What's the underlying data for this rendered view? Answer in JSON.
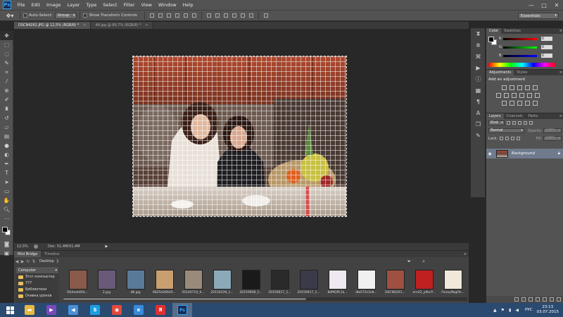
{
  "app": {
    "logo": "Ps"
  },
  "menu": [
    "File",
    "Edit",
    "Image",
    "Layer",
    "Type",
    "Select",
    "Filter",
    "View",
    "Window",
    "Help"
  ],
  "window_controls": {
    "minimize": "—",
    "maximize": "□",
    "close": "✕"
  },
  "options": {
    "auto_select_label": "Auto-Select:",
    "auto_select_target": "Group",
    "show_transform_label": "Show Transform Controls",
    "workspace": "Essentials"
  },
  "doc_tabs": [
    {
      "label": "DSCN4261.JPG @ 12,5% (RGB/8) *",
      "close": "×"
    },
    {
      "label": "48.jpg @ 66,7% (RGB/8) *",
      "close": "×"
    }
  ],
  "status": {
    "zoom": "12,5%",
    "doc_size": "Doc: 51,4M/51,4M",
    "arrow": "▶"
  },
  "bridge": {
    "tabs": [
      "Mini Bridge",
      "Timeline"
    ],
    "path": "Desktop",
    "path_arrow": "❯",
    "location": "Computer",
    "tree": [
      "Этот компьютер",
      "777",
      "Библиотеки",
      "Очивка уроков"
    ],
    "thumbnails": [
      {
        "label": "0Q4xdeD0c...",
        "color": "#8a5a4a"
      },
      {
        "label": "2.jpg",
        "color": "#6a5a7a"
      },
      {
        "label": "48.jpg",
        "color": "#5a7a9a"
      },
      {
        "label": "6825d266d5...",
        "color": "#c8a070"
      },
      {
        "label": "20140710_0...",
        "color": "#9a8a7a"
      },
      {
        "label": "20150228_1...",
        "color": "#8aaab8"
      },
      {
        "label": "20150608_1...",
        "color": "#1a1a1a"
      },
      {
        "label": "20150617_1...",
        "color": "#2a2a2a"
      },
      {
        "label": "20150617_1...",
        "color": "#3a3a4a"
      },
      {
        "label": "8dMQPL1k...",
        "color": "#eee8f0"
      },
      {
        "label": "dbO7Zx1k8...",
        "color": "#f0f0f0"
      },
      {
        "label": "DSCN4261...",
        "color": "#a05040"
      },
      {
        "label": "ern22_y9kcP...",
        "color": "#c02020"
      },
      {
        "label": "Feooy9bgOh...",
        "color": "#f0e8d8"
      }
    ]
  },
  "color_panel": {
    "tabs": [
      "Color",
      "Swatches"
    ],
    "r": {
      "label": "R",
      "value": "0"
    },
    "g": {
      "label": "G",
      "value": "0"
    },
    "b": {
      "label": "B",
      "value": "0"
    }
  },
  "adjustments": {
    "tabs": [
      "Adjustments",
      "Styles"
    ],
    "title": "Add an adjustment"
  },
  "layers": {
    "tabs": [
      "Layers",
      "Channels",
      "Paths"
    ],
    "kind": "Kind",
    "blend_mode": "Normal",
    "opacity_label": "Opacity:",
    "opacity_value": "100%",
    "lock_label": "Lock:",
    "fill_label": "Fill:",
    "fill_value": "100%",
    "items": [
      {
        "name": "Background",
        "visible": true,
        "locked": true
      }
    ]
  },
  "taskbar": {
    "apps": [
      {
        "name": "file-explorer",
        "glyph": "▬",
        "color": "#e8b840"
      },
      {
        "name": "visual-studio",
        "glyph": "▶",
        "color": "#7a4ab8"
      },
      {
        "name": "media",
        "glyph": "◀",
        "color": "#4a90d8"
      },
      {
        "name": "skype",
        "glyph": "S",
        "color": "#1aa0e0"
      },
      {
        "name": "chrome",
        "glyph": "◉",
        "color": "#e04a3a"
      },
      {
        "name": "internet-explorer",
        "glyph": "e",
        "color": "#3a8ad8"
      },
      {
        "name": "yandex",
        "glyph": "Я",
        "color": "#e03030"
      },
      {
        "name": "photoshop",
        "glyph": "Ps",
        "color": "#1b2c4f"
      }
    ],
    "lang": "РУС",
    "time": "23:13",
    "date": "03.07.2015"
  }
}
